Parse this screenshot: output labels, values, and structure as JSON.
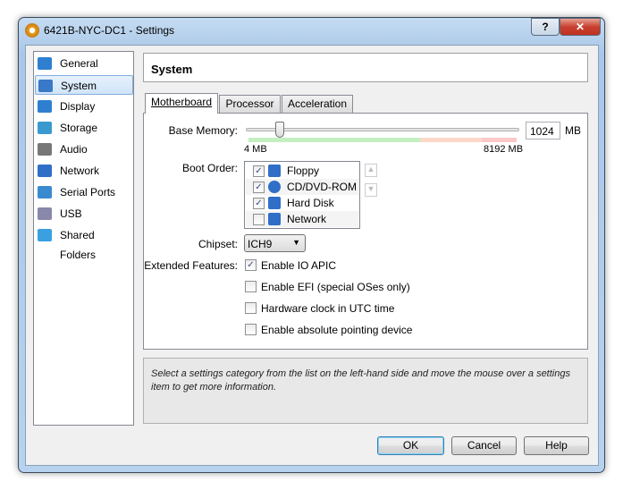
{
  "window": {
    "title": "6421B-NYC-DC1 - Settings",
    "help_label": "?",
    "close_label": "✕"
  },
  "sidebar": {
    "items": [
      {
        "label": "General",
        "icon": "monitor-icon",
        "color": "#2f7fd0"
      },
      {
        "label": "System",
        "icon": "chip-icon",
        "color": "#3a78c8",
        "selected": true
      },
      {
        "label": "Display",
        "icon": "display-icon",
        "color": "#2f7fd0"
      },
      {
        "label": "Storage",
        "icon": "disk-icon",
        "color": "#3a9ad0"
      },
      {
        "label": "Audio",
        "icon": "speaker-icon",
        "color": "#777777"
      },
      {
        "label": "Network",
        "icon": "network-icon",
        "color": "#2f6fc8"
      },
      {
        "label": "Serial Ports",
        "icon": "serial-port-icon",
        "color": "#3a8ad0"
      },
      {
        "label": "USB",
        "icon": "usb-icon",
        "color": "#8888aa"
      },
      {
        "label": "Shared Folders",
        "icon": "folder-icon",
        "color": "#3aa0e0"
      }
    ]
  },
  "header": {
    "title": "System"
  },
  "tabs": [
    {
      "label": "Motherboard",
      "active": true
    },
    {
      "label": "Processor"
    },
    {
      "label": "Acceleration"
    }
  ],
  "motherboard": {
    "base_memory_label": "Base Memory:",
    "memory_value": "1024",
    "memory_unit": "MB",
    "memory_min": "4 MB",
    "memory_max": "8192 MB",
    "memory_fraction": 0.125,
    "boot_order_label": "Boot Order:",
    "boot_items": [
      {
        "label": "Floppy",
        "checked": true,
        "icon": "floppy-icon"
      },
      {
        "label": "CD/DVD-ROM",
        "checked": true,
        "icon": "cd-icon"
      },
      {
        "label": "Hard Disk",
        "checked": true,
        "icon": "hard-disk-icon"
      },
      {
        "label": "Network",
        "checked": false,
        "icon": "network-icon"
      }
    ],
    "chipset_label": "Chipset:",
    "chipset_value": "ICH9",
    "extended_label": "Extended Features:",
    "features": [
      {
        "label": "Enable IO APIC",
        "checked": true
      },
      {
        "label": "Enable EFI (special OSes only)",
        "checked": false
      },
      {
        "label": "Hardware clock in UTC time",
        "checked": false
      },
      {
        "label": "Enable absolute pointing device",
        "checked": false
      }
    ]
  },
  "info": "Select a settings category from the list on the left-hand side and move the mouse over a settings item to get more information.",
  "buttons": {
    "ok": "OK",
    "cancel": "Cancel",
    "help": "Help"
  }
}
